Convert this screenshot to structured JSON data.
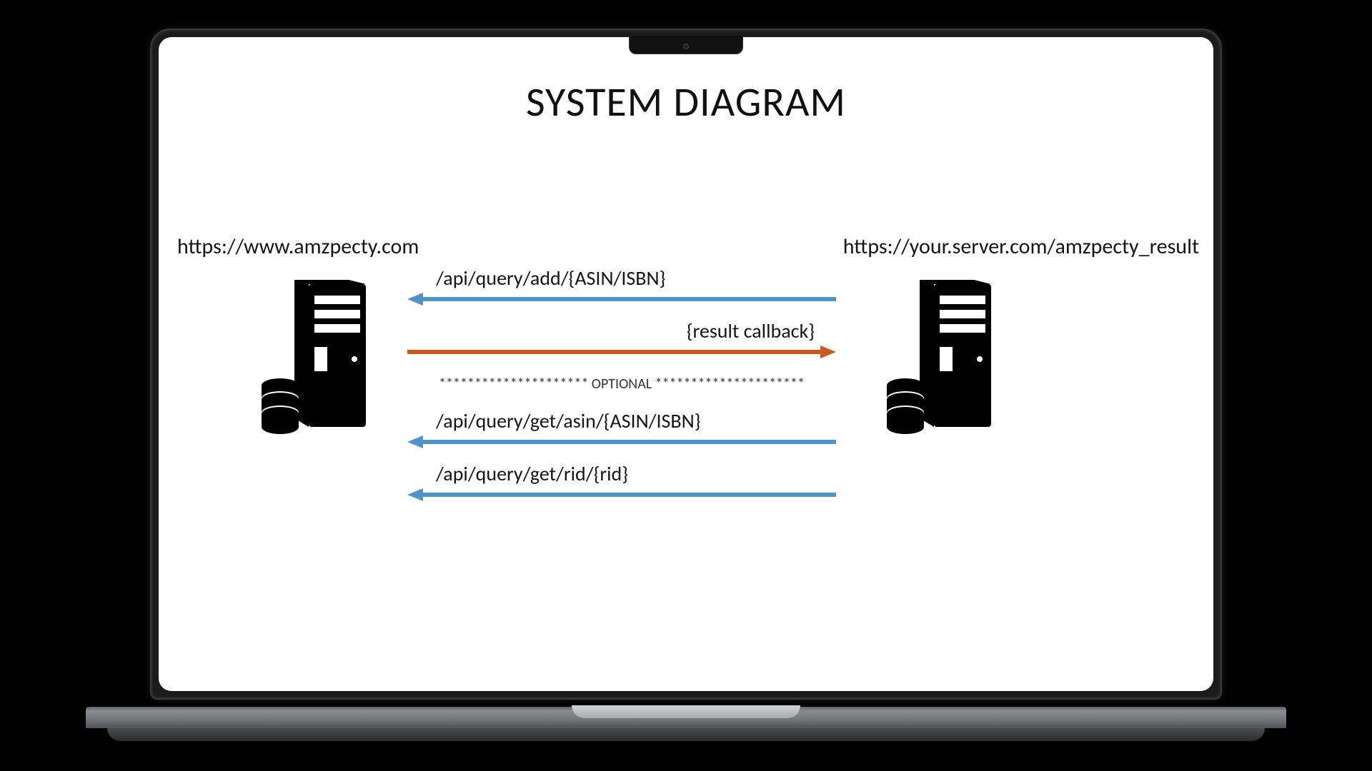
{
  "title": "SYSTEM DIAGRAM",
  "left_server_url": "https://www.amzpecty.com",
  "right_server_url": "https://your.server.com/amzpecty_result",
  "flows": {
    "add": "/api/query/add/{ASIN/ISBN}",
    "callback": "{result callback}",
    "optional_divider": "********************* OPTIONAL *********************",
    "get_asin": "/api/query/get/asin/{ASIN/ISBN}",
    "get_rid": "/api/query/get/rid/{rid}"
  },
  "colors": {
    "arrow_blue": "#4f93c7",
    "arrow_orange": "#c85a1f"
  }
}
